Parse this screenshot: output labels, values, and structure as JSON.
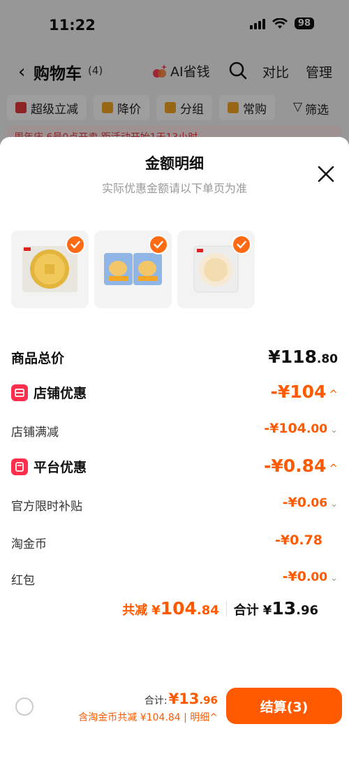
{
  "status": {
    "time": "11:22",
    "battery": "98"
  },
  "nav": {
    "title": "购物车",
    "count": "(4)",
    "ai_label": "AI省钱",
    "compare": "对比",
    "manage": "管理"
  },
  "filters": [
    {
      "label": "超级立减",
      "color": "#e4393c"
    },
    {
      "label": "降价",
      "color": "#f5a623"
    },
    {
      "label": "分组",
      "color": "#f5a623"
    },
    {
      "label": "常购",
      "color": "#f5a623"
    }
  ],
  "filter_btn": "筛选",
  "promo_strip": "周年庆 6号0点开卖 距活动开始1天13小时",
  "sheet": {
    "title": "金额明细",
    "subtitle": "实际优惠金额请以下单页为准"
  },
  "products": [
    {
      "name": "coin-pastry",
      "checked": true
    },
    {
      "name": "cake-pack",
      "checked": true
    },
    {
      "name": "bread-bag",
      "checked": true
    }
  ],
  "breakdown": {
    "total": {
      "label": "商品总价",
      "symbol": "¥",
      "int": "118",
      "dec": ".80"
    },
    "store_discount": {
      "label": "店铺优惠",
      "value": "-¥104"
    },
    "store_full_reduce": {
      "label": "店铺满减",
      "int": "-¥104",
      "dec": ".00"
    },
    "platform_discount": {
      "label": "平台优惠",
      "value": "-¥0.84"
    },
    "official_subsidy": {
      "label": "官方限时补贴",
      "int": "-¥0",
      "dec": ".06"
    },
    "taojinbi": {
      "label": "淘金币",
      "value": "-¥0.78"
    },
    "red_packet": {
      "label": "红包",
      "int": "-¥0",
      "dec": ".00"
    }
  },
  "summary": {
    "reduce_label": "共减",
    "reduce_symbol": "¥",
    "reduce_int": "104",
    "reduce_dec": ".84",
    "total_label": "合计",
    "total_symbol": "¥",
    "total_int": "13",
    "total_dec": ".96"
  },
  "bottom": {
    "total_label": "合计:",
    "total_int": "¥13",
    "total_dec": ".96",
    "saved_text": "含淘金币共减 ¥104.84 | 明细^",
    "checkout_label": "结算(3)"
  },
  "colors": {
    "accent": "#ff5a00",
    "check": "#ff6a13",
    "badge": "#ff2e4d"
  }
}
